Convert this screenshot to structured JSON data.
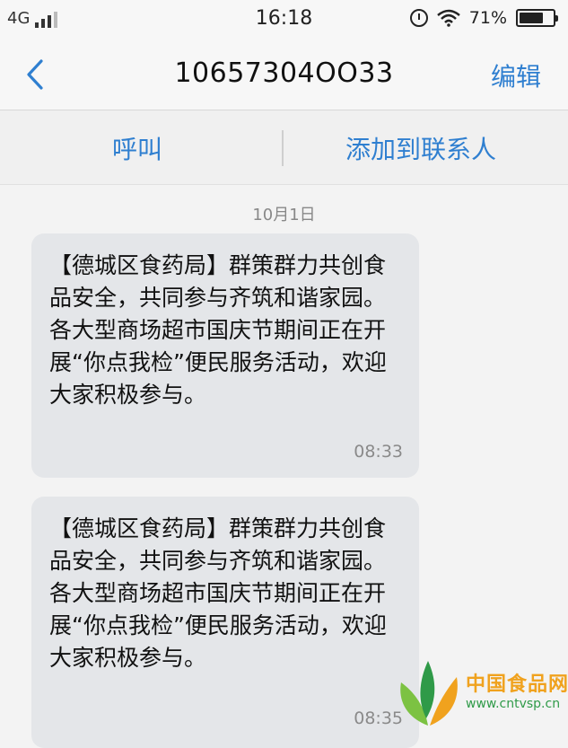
{
  "statusbar": {
    "network": "4G",
    "time": "16:18",
    "battery": "71%",
    "battery_level": 0.71
  },
  "header": {
    "title": "10657304OO33",
    "edit_label": "编辑"
  },
  "actions": {
    "call_label": "呼叫",
    "add_contact_label": "添加到联系人"
  },
  "conversation": {
    "date": "10月1日",
    "messages": [
      {
        "text": "【德城区食药局】群策群力共创食品安全，共同参与齐筑和谐家园。各大型商场超市国庆节期间正在开展“你点我检”便民服务活动，欢迎大家积极参与。",
        "time": "08:33"
      },
      {
        "text": "【德城区食药局】群策群力共创食品安全，共同参与齐筑和谐家园。各大型商场超市国庆节期间正在开展“你点我检”便民服务活动，欢迎大家积极参与。",
        "time": "08:35"
      }
    ]
  },
  "watermark": {
    "name": "中国食品网",
    "url": "www.cntvsp.cn"
  },
  "colors": {
    "accent": "#2f7fd0",
    "bubble": "#e4e6e9",
    "watermark_orange": "#f0a21e",
    "watermark_green": "#2f9a48"
  }
}
